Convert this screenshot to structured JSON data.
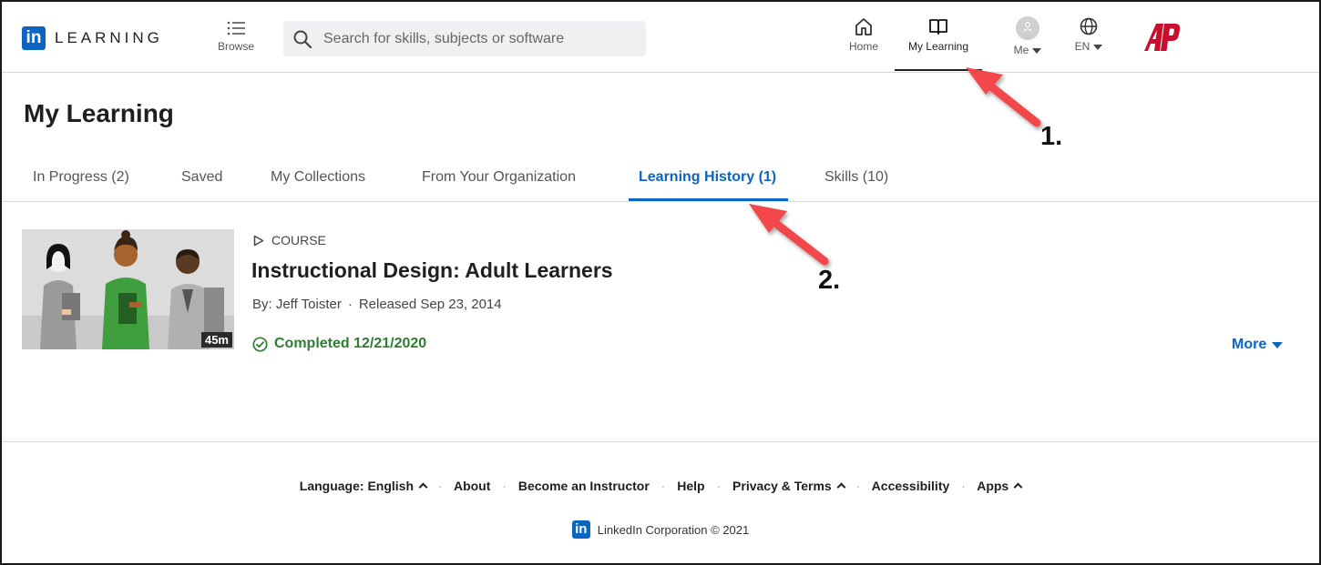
{
  "brand": {
    "logo_text": "LEARNING",
    "in_glyph": "in",
    "accent": "#0a66c2"
  },
  "header": {
    "browse_label": "Browse",
    "search_placeholder": "Search for skills, subjects or software",
    "nav": {
      "home": "Home",
      "my_learning": "My Learning",
      "me": "Me",
      "language": "EN"
    },
    "org_logo": "AP"
  },
  "page": {
    "title": "My Learning",
    "tabs": [
      {
        "label": "In Progress (2)"
      },
      {
        "label": "Saved"
      },
      {
        "label": "My Collections"
      },
      {
        "label": "From Your Organization"
      },
      {
        "label": "Learning History (1)",
        "active": true
      },
      {
        "label": "Skills (10)"
      }
    ]
  },
  "course": {
    "kind": "COURSE",
    "title": "Instructional Design: Adult Learners",
    "author": "By: Jeff Toister",
    "released": "Released Sep 23, 2014",
    "status": "Completed 12/21/2020",
    "duration": "45m",
    "more_label": "More",
    "status_color": "#2f7d32"
  },
  "footer": {
    "language": "Language: English",
    "about": "About",
    "instructor": "Become an Instructor",
    "help": "Help",
    "privacy": "Privacy & Terms",
    "accessibility": "Accessibility",
    "apps": "Apps",
    "copyright": "LinkedIn Corporation © 2021"
  },
  "annotations": {
    "step1": "1.",
    "step2": "2.",
    "arrow_color": "#f2464b"
  }
}
